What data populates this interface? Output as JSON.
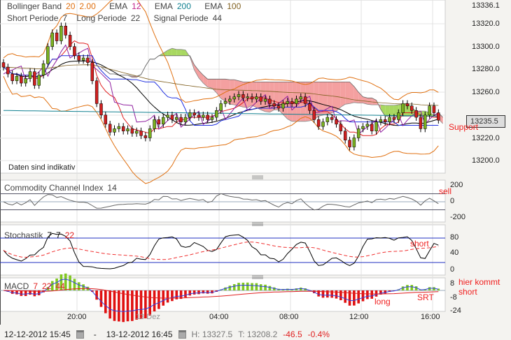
{
  "legend": {
    "bollinger": {
      "label": "Bollinger Band",
      "p1": "20",
      "p2": "2.00",
      "color": "#e07010"
    },
    "ema12": {
      "label": "EMA",
      "value": "12",
      "color": "#c0208a"
    },
    "ema200": {
      "label": "EMA",
      "value": "200",
      "color": "#108090"
    },
    "ema100": {
      "label": "EMA",
      "value": "100",
      "color": "#806020"
    },
    "short": {
      "label": "Short Periode",
      "value": "7"
    },
    "long": {
      "label": "Long Periode",
      "value": "22"
    },
    "signal": {
      "label": "Signal Periode",
      "value": "44"
    }
  },
  "main": {
    "disclaimer": "Daten sind indikativ",
    "y_labels": [
      "13336.1",
      "13320.0",
      "13300.0",
      "13280.0",
      "13260.0",
      "13220.0",
      "13200.0"
    ],
    "current_price": "13235.5",
    "note_support": "Support"
  },
  "cci": {
    "label": "Commodity Channel Index",
    "period": "14",
    "y_labels": [
      "200",
      "0",
      "-200"
    ],
    "note": "sell"
  },
  "stoch": {
    "label": "Stochastik",
    "p1": "7",
    "p2": "7",
    "p3": "22",
    "y_labels": [
      "80",
      "40",
      "0"
    ],
    "note": "short"
  },
  "macd": {
    "label": "MACD",
    "p1": "7",
    "p2": "22",
    "p3": "44",
    "y_labels": [
      "8",
      "-8",
      "-24"
    ],
    "note_long": "long",
    "note_srt": "SRT",
    "note_hier": "hier kommt",
    "note_short": "short"
  },
  "x_labels": [
    "20:00",
    "13 Dez",
    "04:00",
    "08:00",
    "12:00",
    "16:00"
  ],
  "status": {
    "from": "12-12-2012 15:45",
    "sep": "-",
    "to": "13-12-2012 16:45",
    "high": "H: 13327.5",
    "low": "T: 13208.2",
    "change": "-46.5",
    "change_pct": "-0.4%"
  },
  "chart_data": {
    "type": "candlestick",
    "interval": "15min",
    "closes": [
      13282,
      13276,
      13270,
      13274,
      13268,
      13272,
      13278,
      13266,
      13275,
      13285,
      13300,
      13312,
      13305,
      13318,
      13310,
      13300,
      13292,
      13288,
      13290,
      13286,
      13270,
      13250,
      13240,
      13232,
      13225,
      13228,
      13230,
      13226,
      13228,
      13224,
      13226,
      13222,
      13220,
      13228,
      13236,
      13232,
      13238,
      13240,
      13236,
      13238,
      13234,
      13238,
      13242,
      13240,
      13238,
      13240,
      13236,
      13238,
      13244,
      13250,
      13252,
      13254,
      13256,
      13258,
      13255,
      13256,
      13254,
      13256,
      13252,
      13254,
      13250,
      13248,
      13246,
      13250,
      13252,
      13250,
      13254,
      13256,
      13250,
      13244,
      13236,
      13230,
      13234,
      13238,
      13236,
      13232,
      13226,
      13218,
      13212,
      13220,
      13228,
      13230,
      13232,
      13226,
      13234,
      13236,
      13234,
      13238,
      13236,
      13242,
      13250,
      13248,
      13244,
      13238,
      13228,
      13240,
      13248,
      13242,
      13235.5
    ],
    "ylim": [
      13190,
      13336.1
    ]
  }
}
